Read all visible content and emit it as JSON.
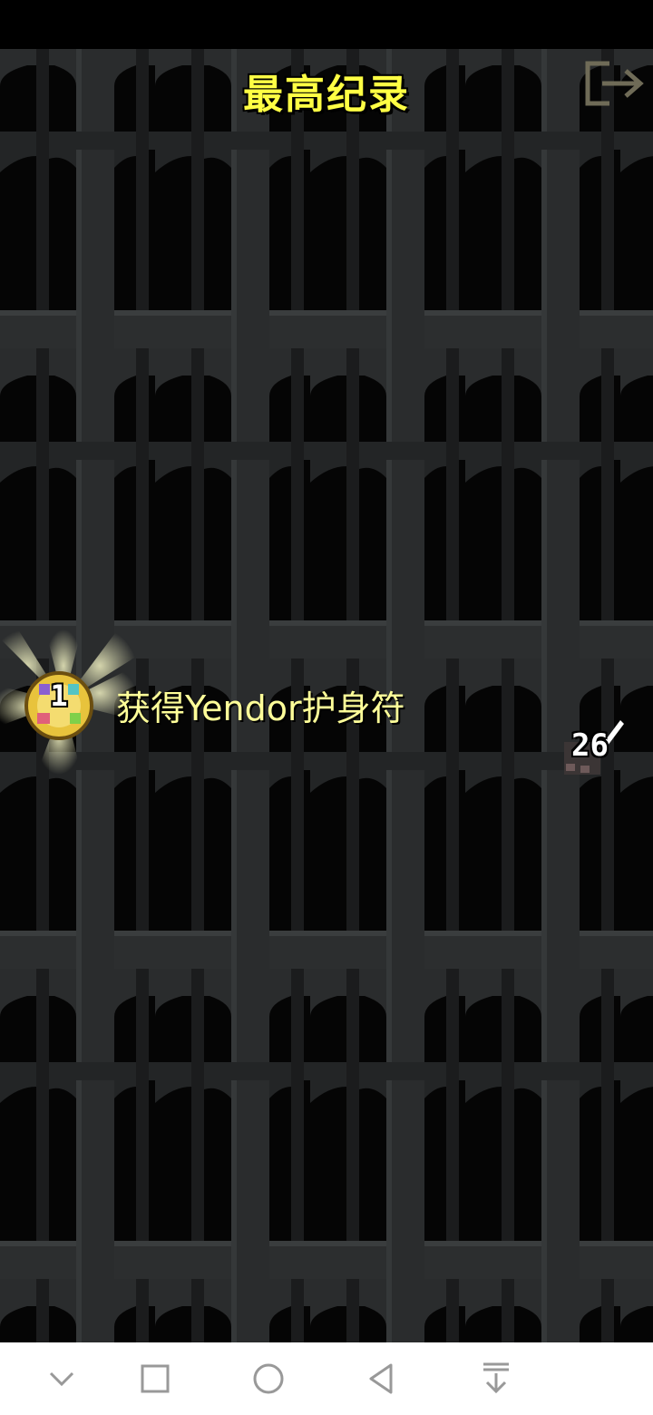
{
  "header": {
    "title": "最高纪录",
    "exit_icon": "exit-icon"
  },
  "records": [
    {
      "rank": "1",
      "description": "获得Yendor护身符",
      "depth": "26",
      "icon": "amulet-of-yendor-icon",
      "depth_icon": "sword-depth-icon"
    }
  ],
  "colors": {
    "title": "#ffff44",
    "record_text": "#ffff99",
    "background": "#2a2c2d"
  },
  "nav_bar": {
    "icons": [
      "chevron-down-icon",
      "recent-apps-icon",
      "home-icon",
      "back-icon",
      "notification-pull-icon"
    ]
  }
}
